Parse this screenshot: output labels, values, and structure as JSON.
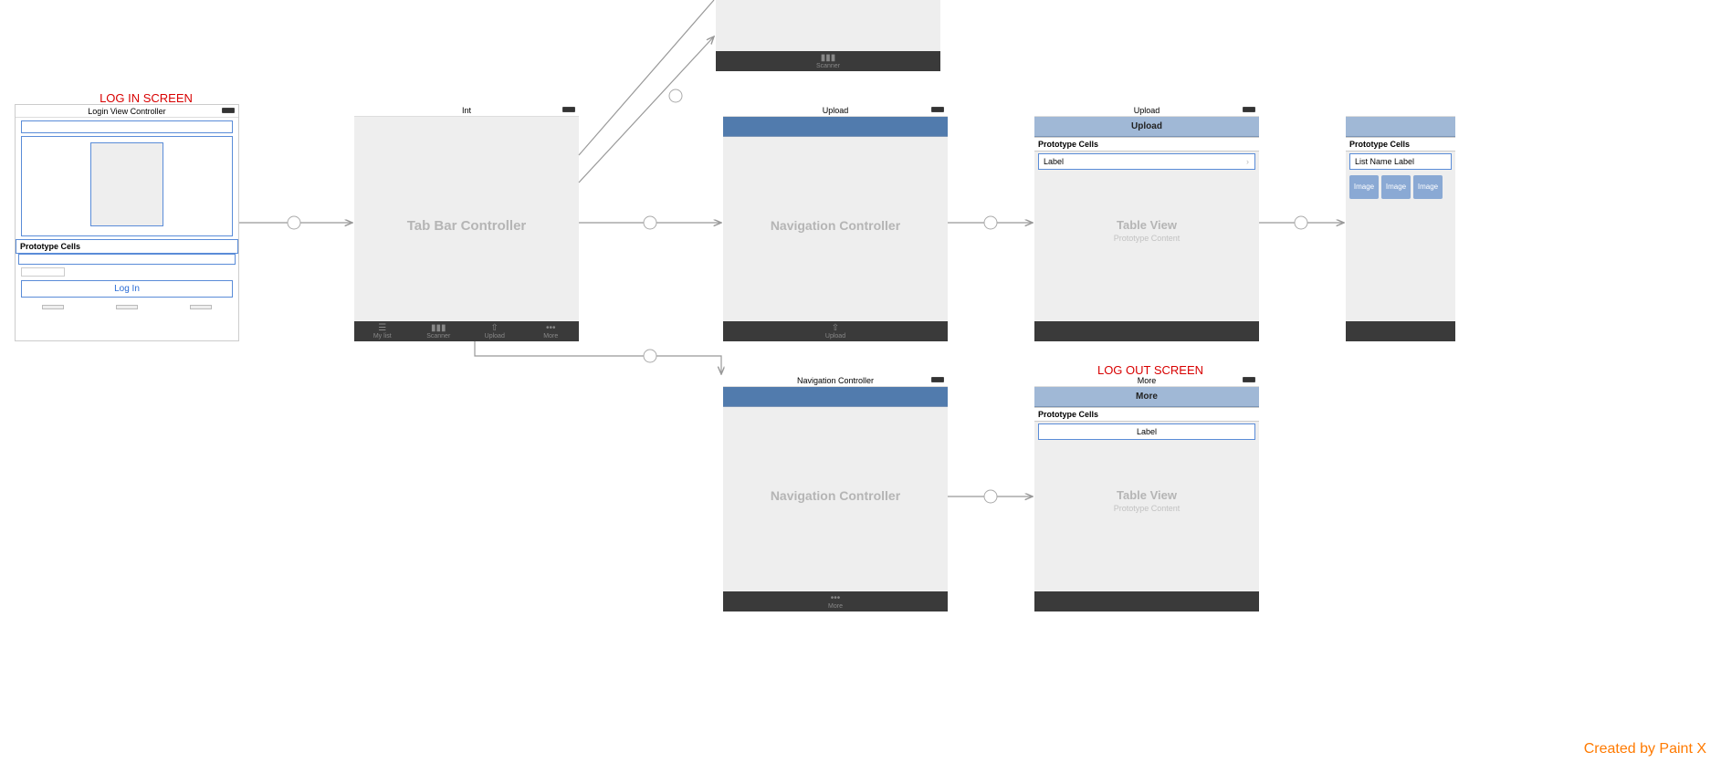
{
  "labels": {
    "login": "LOG IN SCREEN",
    "logout": "LOG OUT SCREEN"
  },
  "login": {
    "title": "Login View Controller",
    "proto": "Prototype Cells",
    "button": "Log In"
  },
  "tabbar": {
    "title": "Int",
    "placeholder": "Tab Bar Controller",
    "tabs": [
      "My list",
      "Scanner",
      "Upload",
      "More"
    ]
  },
  "partialTop": {
    "tab": "Scanner"
  },
  "navUpload": {
    "title": "Upload",
    "placeholder": "Navigation Controller",
    "tab": "Upload"
  },
  "tableUpload": {
    "title": "Upload",
    "nav": "Upload",
    "proto": "Prototype Cells",
    "cell": "Label",
    "placeholder": "Table View",
    "sub": "Prototype Content"
  },
  "tableRight": {
    "proto": "Prototype Cells",
    "cell": "List Name Label",
    "thumbs": [
      "Image",
      "Image",
      "Image"
    ]
  },
  "navMore": {
    "title": "Navigation Controller",
    "placeholder": "Navigation Controller",
    "tab": "More"
  },
  "tableMore": {
    "title": "More",
    "nav": "More",
    "proto": "Prototype Cells",
    "cell": "Label",
    "placeholder": "Table View",
    "sub": "Prototype Content"
  },
  "watermark": "Created by Paint X"
}
